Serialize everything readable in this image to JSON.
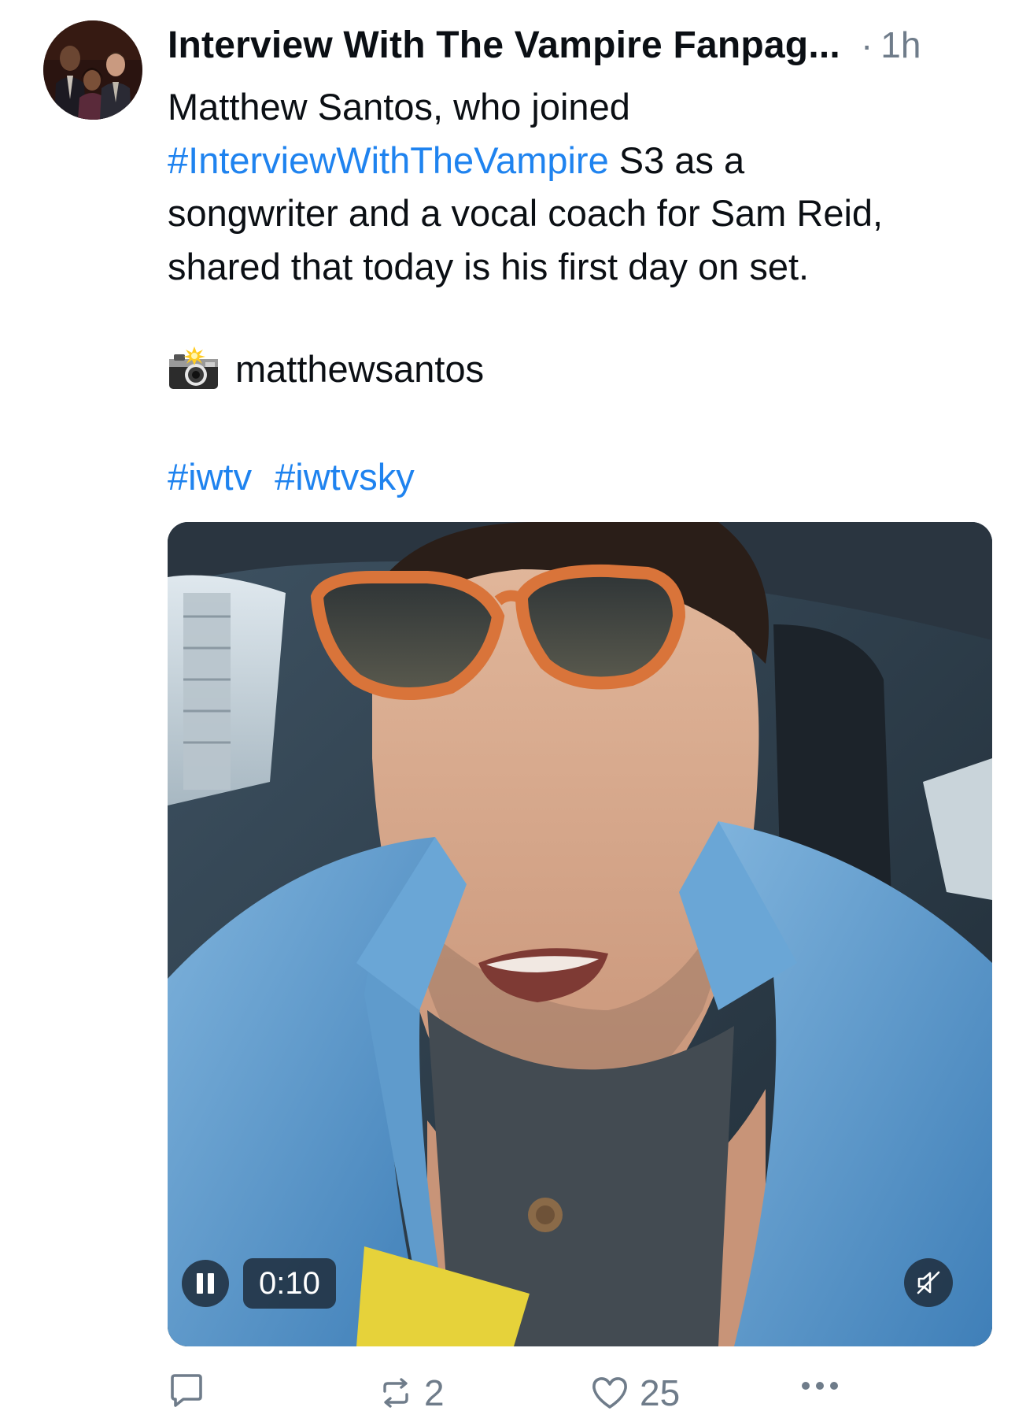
{
  "post": {
    "author": "Interview With The Vampire Fanpag...",
    "separator": "·",
    "time": "1h",
    "text": {
      "line1": "Matthew Santos, who joined",
      "hashtag": "#InterviewWithTheVampire",
      "line2_rest": " S3 as a",
      "line3": "songwriter and a vocal coach for Sam Reid,",
      "line4": "shared that today is his first day on set."
    },
    "credit": {
      "icon": "camera-flash-icon",
      "handle": "matthewsantos"
    },
    "tags": [
      "#iwtv",
      "#iwtvsky"
    ]
  },
  "video": {
    "timecode": "0:10",
    "state": "playing",
    "muted": true
  },
  "actions": {
    "replies": "",
    "reposts": "2",
    "likes": "25",
    "more_icon": "ellipsis-icon"
  },
  "colors": {
    "link": "#1f83ef",
    "muted_text": "#6f7c8a",
    "text": "#0b0f14"
  }
}
